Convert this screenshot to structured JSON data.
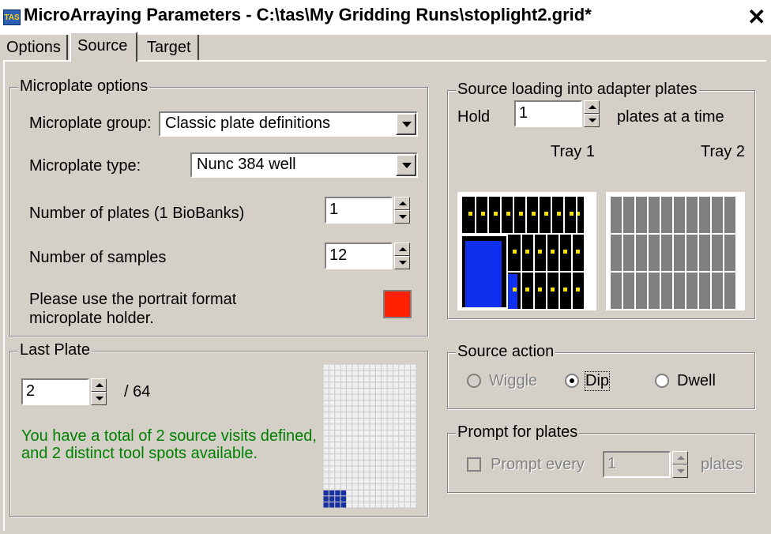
{
  "window": {
    "title": "MicroArraying Parameters - C:\\tas\\My Gridding Runs\\stoplight2.grid*",
    "icon": "app-icon",
    "close": "close-icon"
  },
  "tabs": [
    {
      "label": "Options",
      "selected": false
    },
    {
      "label": "Source",
      "selected": true
    },
    {
      "label": "Target",
      "selected": false
    }
  ],
  "microplate": {
    "legend": "Microplate options",
    "group_label": "Microplate group:",
    "group_value": "Classic plate definitions",
    "type_label": "Microplate type:",
    "type_value": "Nunc 384 well",
    "plates_label": "Number of plates (1 BioBanks)",
    "plates_value": "1",
    "samples_label": "Number of samples",
    "samples_value": "12",
    "note_line1": "Please use the portrait format",
    "note_line2": "microplate holder.",
    "indicator_color": "#ff2000"
  },
  "last_plate": {
    "legend": "Last Plate",
    "value": "2",
    "total": "/ 64",
    "msg_line1": "You have a total of 2 source visits defined,",
    "msg_line2": "and 2 distinct tool spots available.",
    "msg_color": "#008000"
  },
  "source_loading": {
    "legend": "Source loading into adapter plates",
    "hold_label": "Hold",
    "hold_value": "1",
    "suffix": "plates at a time",
    "tray1": "Tray 1",
    "tray2": "Tray 2"
  },
  "source_action": {
    "legend": "Source action",
    "options": [
      {
        "label": "Wiggle",
        "checked": false,
        "enabled": false
      },
      {
        "label": "Dip",
        "checked": true,
        "enabled": true
      },
      {
        "label": "Dwell",
        "checked": false,
        "enabled": true
      }
    ]
  },
  "prompt": {
    "legend": "Prompt for plates",
    "check_label": "Prompt every",
    "value": "1",
    "suffix": "plates",
    "checked": false,
    "enabled": false
  }
}
